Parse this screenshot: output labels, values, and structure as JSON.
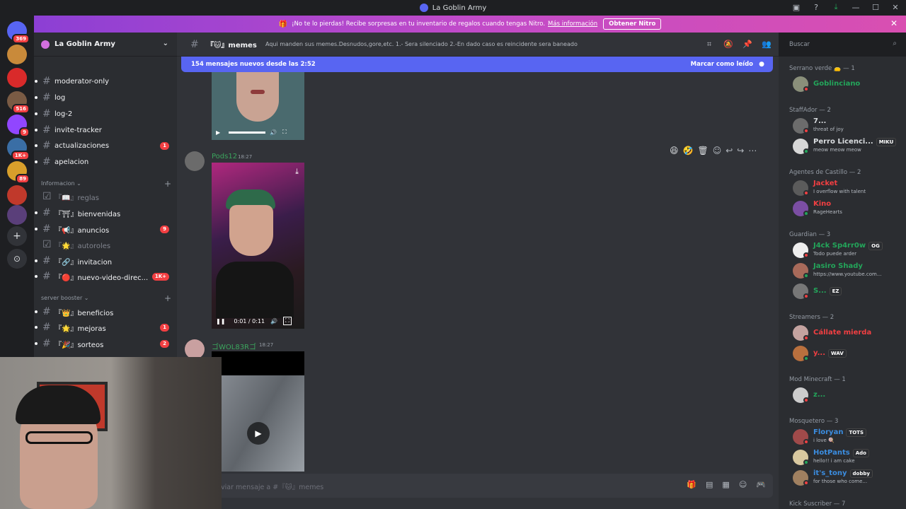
{
  "window": {
    "title": "La Goblin Army"
  },
  "guilds": [
    {
      "name": "home",
      "badge": "369",
      "color": "#5865f2"
    },
    {
      "name": "server-1",
      "badge": "",
      "color": "#c98a3a"
    },
    {
      "name": "server-2",
      "badge": "",
      "color": "#d92a2a"
    },
    {
      "name": "server-3",
      "badge": "516",
      "color": "#7a5b44"
    },
    {
      "name": "server-4",
      "badge": "9",
      "color": "#9146ff"
    },
    {
      "name": "server-5",
      "badge": "1K+",
      "color": "#3a6ea5"
    },
    {
      "name": "server-6",
      "badge": "89",
      "color": "#d89f2b"
    },
    {
      "name": "server-7",
      "badge": "",
      "color": "#c0392b"
    },
    {
      "name": "server-8",
      "badge": "",
      "color": "#5a3f7a"
    }
  ],
  "nitro": {
    "text": "¡No te lo pierdas! Recibe sorpresas en tu inventario de regalos cuando tengas Nitro.",
    "link": "Más información",
    "button": "Obtener Nitro"
  },
  "server": {
    "name": "La Goblin Army"
  },
  "channels": [
    {
      "name": "moderator-only",
      "muted": false,
      "badge": ""
    },
    {
      "name": "log",
      "muted": false,
      "badge": ""
    },
    {
      "name": "log-2",
      "muted": false,
      "badge": ""
    },
    {
      "name": "invite-tracker",
      "muted": false,
      "badge": ""
    },
    {
      "name": "actualizaciones",
      "muted": false,
      "badge": "1"
    },
    {
      "name": "apelacion",
      "muted": false,
      "badge": ""
    }
  ],
  "categories": {
    "informacion": "Informacion",
    "booster": "server booster"
  },
  "info_channels": [
    {
      "name": "『📖』reglas",
      "muted": true,
      "badge": ""
    },
    {
      "name": "『⛩』bienvenidas",
      "muted": false,
      "badge": ""
    },
    {
      "name": "『📢』anuncios",
      "muted": false,
      "badge": "9"
    },
    {
      "name": "『🌟』autoroles",
      "muted": true,
      "badge": ""
    },
    {
      "name": "『🔗』invitacion",
      "muted": false,
      "badge": ""
    },
    {
      "name": "『🔴』nuevo-video-direc...",
      "muted": false,
      "badge": "1K+"
    }
  ],
  "booster_channels": [
    {
      "name": "『👑』beneficios",
      "muted": false,
      "badge": ""
    },
    {
      "name": "『🌟』mejoras",
      "muted": false,
      "badge": "1"
    },
    {
      "name": "『🎉』sorteos",
      "muted": false,
      "badge": "2"
    }
  ],
  "chat": {
    "channel": "『🐱』memes",
    "topic": "Aqui manden sus memes.Desnudos,gore,etc. 1.- Sera silenciado 2.-En dado caso es reincidente sera baneado",
    "search_placeholder": "Buscar",
    "new_messages": "154 mensajes nuevos desde las 2:52",
    "mark_read": "Marcar como leído",
    "input_placeholder": "viar mensaje a #『🐱』memes"
  },
  "messages": [
    {
      "author": "Pods12",
      "time": "18:27",
      "video_time": "0:01 / 0:11",
      "author_color": "#3ba55d"
    },
    {
      "author": "ゴWOL83Rゴ",
      "time": "18:27",
      "author_color": "#3ba55d"
    }
  ],
  "members": {
    "groups": [
      {
        "title": "Serrano verde 👝 — 1",
        "items": [
          {
            "name": "Goblinciano",
            "status": "",
            "tag": "",
            "color": "#23a55a"
          }
        ]
      },
      {
        "title": "StaffAdor — 2",
        "items": [
          {
            "name": "7...",
            "status": "threat of joy",
            "tag": "",
            "color": "#dbdee1"
          },
          {
            "name": "Perro Licenci...",
            "status": "meow meow meow",
            "tag": "MIKU",
            "color": "#dbdee1"
          }
        ]
      },
      {
        "title": "Agentes de Castillo — 2",
        "items": [
          {
            "name": "Jacket",
            "status": "I overflow with talent",
            "tag": "",
            "color": "#f23f42"
          },
          {
            "name": "Kino",
            "status": "RageHearts",
            "tag": "",
            "color": "#f23f42"
          }
        ]
      },
      {
        "title": "Guardian — 3",
        "items": [
          {
            "name": "J4ck Sp4rr0w",
            "status": "Todo puede arder",
            "tag": "OG",
            "color": "#23a55a"
          },
          {
            "name": "Jasiro Shady",
            "status": "https://www.youtube.com...",
            "tag": "",
            "color": "#23a55a"
          },
          {
            "name": "S...",
            "status": "",
            "tag": "EZ",
            "color": "#23a55a"
          }
        ]
      },
      {
        "title": "Streamers — 2",
        "items": [
          {
            "name": "Cállate mierda",
            "status": "",
            "tag": "",
            "color": "#f23f42"
          },
          {
            "name": "y...",
            "status": "",
            "tag": "WAV",
            "color": "#f23f42"
          }
        ]
      },
      {
        "title": "Mod Minecraft — 1",
        "items": [
          {
            "name": "z...",
            "status": "",
            "tag": "",
            "color": "#23a55a"
          }
        ]
      },
      {
        "title": "Mosquetero — 3",
        "items": [
          {
            "name": "Floryan",
            "status": "i love 🍭",
            "tag": "TOTS",
            "color": "#3b8de0"
          },
          {
            "name": "HotPants",
            "status": "hello!! i am cake",
            "tag": "Ado",
            "color": "#3b8de0"
          },
          {
            "name": "it's_tony",
            "status": "for those who come...",
            "tag": "dobby",
            "color": "#3b8de0"
          }
        ]
      },
      {
        "title": "Kick Suscriber — 7",
        "items": []
      }
    ]
  }
}
